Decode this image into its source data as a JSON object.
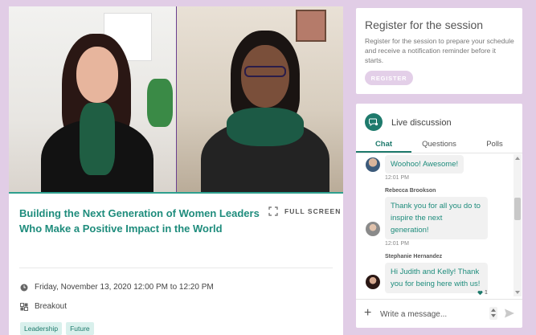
{
  "session": {
    "title": "Building the Next Generation of Women Leaders Who Make a Positive Impact in the World",
    "fullscreen_label": "FULL SCREEN",
    "date": "Friday, November 13, 2020 12:00 PM to 12:20 PM",
    "type": "Breakout",
    "tags": [
      "Leadership",
      "Future"
    ]
  },
  "register": {
    "title": "Register for the session",
    "description": "Register for the session to prepare your schedule and receive a notification reminder before it starts.",
    "button_label": "REGISTER"
  },
  "discussion": {
    "title": "Live discussion",
    "tabs": [
      "Chat",
      "Questions",
      "Polls"
    ],
    "active_tab": "Chat",
    "messages": [
      {
        "sender": "",
        "text": "Woohoo! Awesome!",
        "time": "12:01 PM"
      },
      {
        "sender": "Rebecca Brookson",
        "text": "Thank you for all you do to inspire the next generation!",
        "time": "12:01 PM"
      },
      {
        "sender": "Stephanie Hernandez",
        "text": "Hi Judith and Kelly! Thank you for being here with us!",
        "likes": "1"
      }
    ],
    "input_placeholder": "Write a message..."
  },
  "colors": {
    "background": "#e1cde6",
    "accent": "#1e8c7c",
    "register_button": "#e3cfe8"
  },
  "icons": {
    "fullscreen": "fullscreen-icon",
    "date": "clock-icon",
    "type": "breakout-icon",
    "discussion": "chat-bubble-icon",
    "add": "plus-icon",
    "send": "send-icon",
    "like": "heart-icon"
  }
}
